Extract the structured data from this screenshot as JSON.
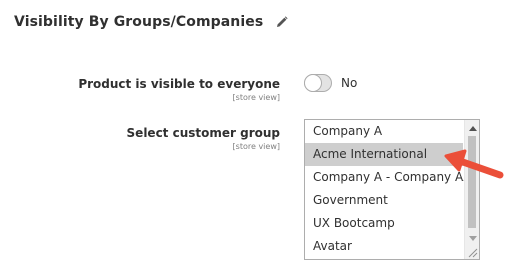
{
  "section": {
    "title": "Visibility By Groups/Companies",
    "edit_icon": "pencil-icon"
  },
  "visibility_field": {
    "label": "Product is visible to everyone",
    "scope": "[store view]",
    "toggle_state": "off",
    "toggle_text": "No"
  },
  "group_field": {
    "label": "Select customer group",
    "scope": "[store view]",
    "options": [
      "Company A",
      "Acme International",
      "Company A - Company AAA",
      "Government",
      "UX Bootcamp",
      "Avatar"
    ],
    "selected": "Acme International"
  },
  "annotation": {
    "arrow_color": "#eb4f39",
    "points_to": "Acme International"
  },
  "colors": {
    "selected_option_bg": "#cecece",
    "text": "#303030",
    "scope_text": "#808080"
  }
}
